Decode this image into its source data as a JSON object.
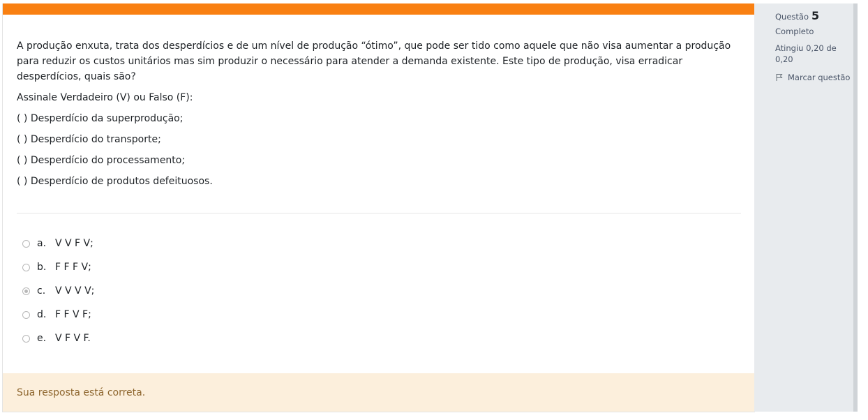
{
  "question": {
    "paragraph": "A produção enxuta, trata dos desperdícios e de um nível de produção “ótimo”, que pode ser tido como aquele que não visa aumentar a produção para reduzir os custos unitários mas sim produzir o necessário para atender a demanda existente. Este tipo de produção, visa erradicar desperdícios, quais são?",
    "instruction": "Assinale Verdadeiro (V) ou Falso (F):",
    "items": [
      "( ) Desperdício da superprodução;",
      "( ) Desperdício do transporte;",
      "( ) Desperdício do processamento;",
      "( ) Desperdício de produtos defeituosos."
    ]
  },
  "answers": [
    {
      "letter": "a.",
      "text": "V V F V;",
      "checked": false
    },
    {
      "letter": "b.",
      "text": "F F F V;",
      "checked": false
    },
    {
      "letter": "c.",
      "text": "V V V V;",
      "checked": true
    },
    {
      "letter": "d.",
      "text": "F F V F;",
      "checked": false
    },
    {
      "letter": "e.",
      "text": "V F V F.",
      "checked": false
    }
  ],
  "feedback": "Sua resposta está correta.",
  "info": {
    "question_label": "Questão",
    "question_number": "5",
    "state": "Completo",
    "grade": "Atingiu 0,20 de 0,20",
    "flag_label": "Marcar questão"
  },
  "colors": {
    "accent": "#f98012",
    "feedback_bg": "#fcefdc",
    "feedback_text": "#8e662e",
    "sidebar_bg": "#e8ebee"
  }
}
